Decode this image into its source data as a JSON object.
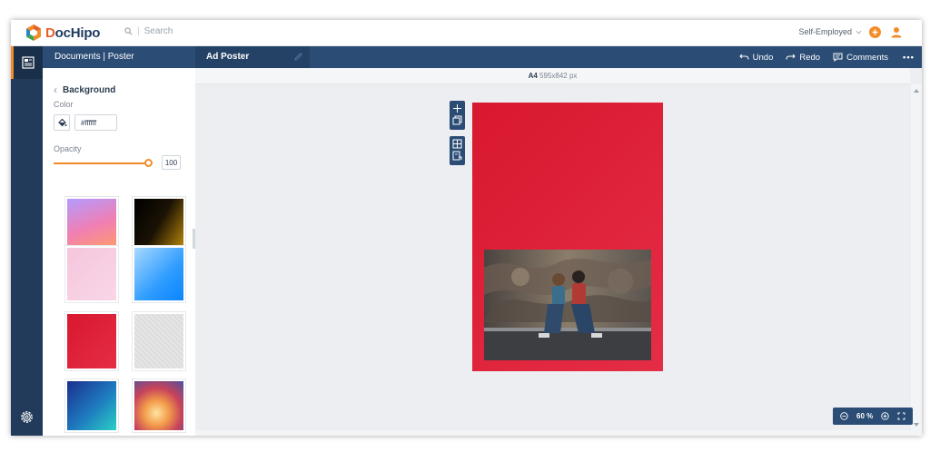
{
  "app": {
    "logo_prefix": "D",
    "logo_rest": "ocHipo",
    "search_placeholder": "Search",
    "account_label": "Self-Employed",
    "accent": "#f28c28",
    "navy": "#2b4c75"
  },
  "docbar": {
    "breadcrumb": "Documents | Poster",
    "doc_name": "Ad Poster",
    "undo": "Undo",
    "redo": "Redo",
    "comments": "Comments",
    "more": "•••"
  },
  "panel": {
    "back_label": "Background",
    "color_label": "Color",
    "color_value": "#ffffff",
    "opacity_label": "Opacity",
    "opacity_value": "100",
    "swatches": [
      {
        "name": "pink-purple-gradient",
        "css": "linear-gradient(160deg,#b39bff 0%,#f07fb3 55%,#ff9a6b 100%)"
      },
      {
        "name": "black-gold-gradient",
        "css": "linear-gradient(120deg,#000 0%,#1a1204 50%,#b8860b 100%)"
      },
      {
        "name": "light-pink",
        "css": "linear-gradient(135deg,#f5c6dd 0%,#f9d6e7 100%)"
      },
      {
        "name": "sky-blue-gradient",
        "css": "linear-gradient(135deg,#a8d8ff 0%,#2e9cff 60%,#0a84ff 100%)"
      },
      {
        "name": "red-gradient",
        "css": "linear-gradient(135deg,#d8182e 0%,#e52d46 100%)"
      },
      {
        "name": "grey-texture",
        "css": "repeating-linear-gradient(45deg,#dcdcdc 0,#e9e9e9 2px,#d6d6d6 4px)"
      },
      {
        "name": "navy-teal-gradient",
        "css": "linear-gradient(135deg,#1b2f8c 0%,#1e7bbf 55%,#2ad0c5 100%)"
      },
      {
        "name": "colorful-polygon",
        "css": "radial-gradient(circle at 45% 65%,#ffe4a0 0%,#f29b4a 30%,#c8435a 60%,#4d4fa0 100%)"
      }
    ]
  },
  "canvas": {
    "page_size_label": "A4",
    "page_size_value": "595x842 px",
    "poster_color": "#d8182e",
    "zoom_value": "60 %"
  }
}
